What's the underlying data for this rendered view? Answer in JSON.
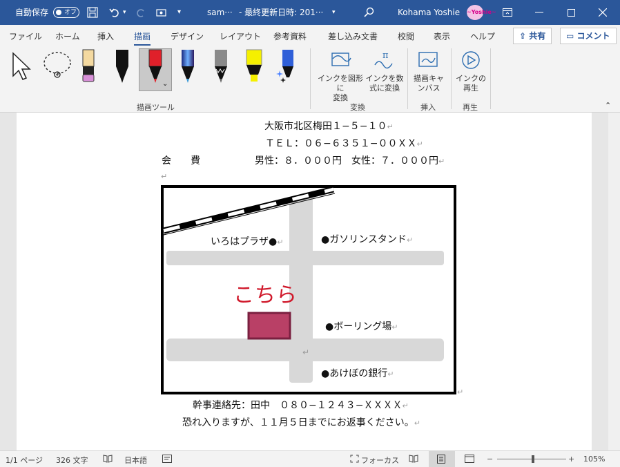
{
  "titlebar": {
    "autosave_label": "自動保存",
    "autosave_state": "オフ",
    "doc_name": "sam···",
    "modified": "-  最終更新日時: 201···",
    "user": "Kohama Yoshie",
    "avatar_text": "~Yoshie~"
  },
  "tabs": [
    "ファイル",
    "ホーム",
    "挿入",
    "描画",
    "デザイン",
    "レイアウト",
    "参考資料",
    "差し込み文書",
    "校閲",
    "表示",
    "ヘルプ"
  ],
  "active_tab": "描画",
  "share_label": "共有",
  "comment_label": "コメント",
  "ribbon": {
    "draw_tools_label": "描画ツール",
    "ink_to_shape": "インクを図形に\n変換",
    "ink_to_math": "インクを数\n式に変換",
    "convert_label": "変換",
    "canvas": "描画キャ\nンバス",
    "insert_label": "挿入",
    "replay": "インクの\n再生",
    "replay_label": "再生"
  },
  "pens": [
    {
      "name": "pen-black",
      "color": "#111111"
    },
    {
      "name": "pen-red",
      "color": "#e0202a"
    },
    {
      "name": "pen-galaxy",
      "color": "#3a6fd8"
    },
    {
      "name": "pencil-gray",
      "color": "#8a8a8a"
    },
    {
      "name": "highlighter-yellow",
      "color": "#f5f000"
    },
    {
      "name": "pen-sparkle",
      "color": "#3050c8"
    }
  ],
  "document": {
    "address": "大阪市北区梅田１−５−１０",
    "tel": "ＴＥＬ：０６−６３５１−００ＸＸ",
    "fee_label": "会　　費",
    "fee_values": "男性：８．０００円　女性：７．０００円",
    "map": {
      "iroha": "いろはプラザ●",
      "gas": "●ガソリンスタンド",
      "kochira": "こちら",
      "bowling": "●ボーリング場",
      "bank": "●あけぼの銀行"
    },
    "contact": "幹事連絡先：田中　０８０−１２４３−ＸＸＸＸ",
    "request": "恐れ入りますが、１１月５日までにお返事ください。"
  },
  "para_mark": "↵",
  "statusbar": {
    "page": "1/1 ページ",
    "words": "326 文字",
    "language": "日本語",
    "focus": "フォーカス",
    "zoom": "105%",
    "zoom_fraction": 0.52
  }
}
